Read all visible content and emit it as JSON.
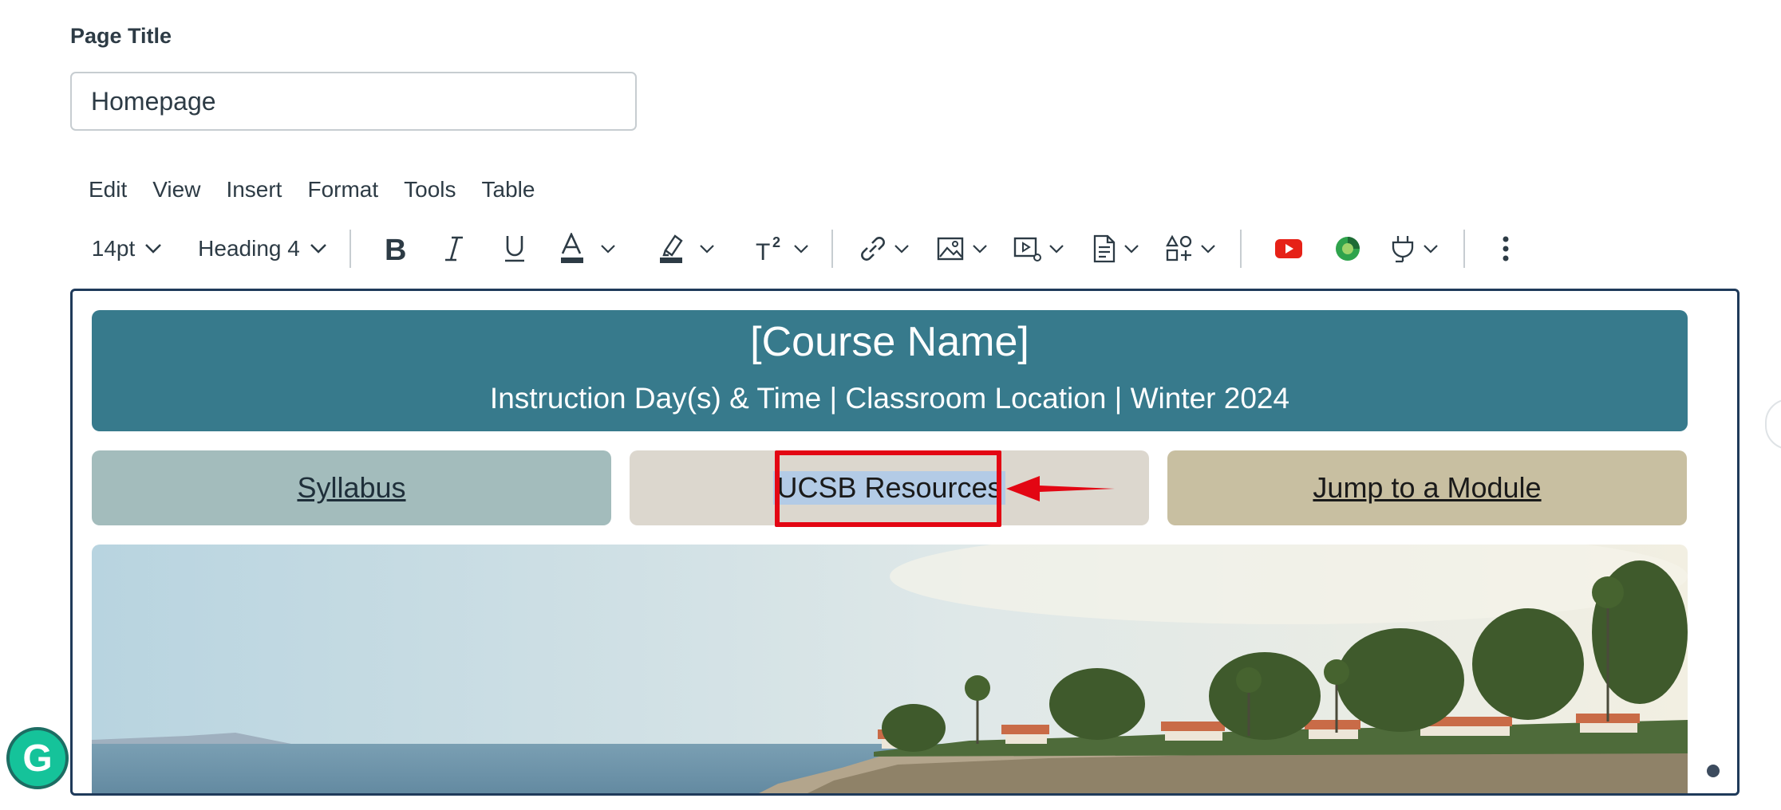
{
  "page": {
    "title_label": "Page Title",
    "title_value": "Homepage"
  },
  "menubar": {
    "items": [
      "Edit",
      "View",
      "Insert",
      "Format",
      "Tools",
      "Table"
    ]
  },
  "toolbar": {
    "font_size": "14pt",
    "block_format": "Heading 4",
    "icons": [
      "bold-icon",
      "italic-icon",
      "underline-icon",
      "text-color-icon",
      "highlight-icon",
      "superscript-icon",
      "link-icon",
      "image-icon",
      "media-icon",
      "document-icon",
      "apps-icon",
      "youtube-icon",
      "studio-icon",
      "plugin-icon",
      "more-icon"
    ]
  },
  "editor": {
    "banner": {
      "course_name": "[Course Name]",
      "subtitle": "Instruction Day(s) & Time | Classroom Location | Winter 2024",
      "color": "#377a8c"
    },
    "buttons": {
      "syllabus": "Syllabus",
      "resources": "UCSB Resources",
      "module": "Jump to a Module"
    },
    "annotation_color": "#e30613"
  }
}
